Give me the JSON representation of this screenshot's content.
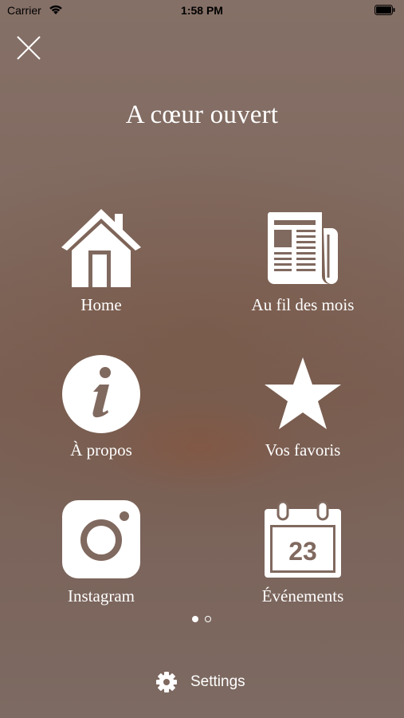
{
  "status_bar": {
    "carrier": "Carrier",
    "time": "1:58 PM"
  },
  "header": {
    "title": "A cœur ouvert",
    "close_icon": "close-icon"
  },
  "menu": {
    "items": [
      {
        "label": "Home",
        "icon": "home-icon"
      },
      {
        "label": "Au fil des mois",
        "icon": "newspaper-icon"
      },
      {
        "label": "À propos",
        "icon": "info-icon"
      },
      {
        "label": "Vos favoris",
        "icon": "star-icon"
      },
      {
        "label": "Instagram",
        "icon": "instagram-icon"
      },
      {
        "label": "Événements",
        "icon": "calendar-icon",
        "calendar_day": "23"
      }
    ]
  },
  "pagination": {
    "current_page": 1,
    "total_pages": 2
  },
  "footer": {
    "settings_label": "Settings",
    "icon": "gear-icon"
  },
  "colors": {
    "foreground": "#ffffff",
    "background": "#7f675d"
  }
}
